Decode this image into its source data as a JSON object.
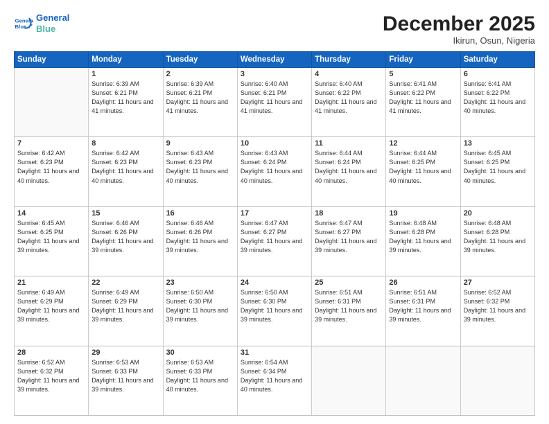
{
  "header": {
    "logo_line1": "General",
    "logo_line2": "Blue",
    "month": "December 2025",
    "location": "Ikirun, Osun, Nigeria"
  },
  "weekdays": [
    "Sunday",
    "Monday",
    "Tuesday",
    "Wednesday",
    "Thursday",
    "Friday",
    "Saturday"
  ],
  "weeks": [
    [
      {
        "day": "",
        "empty": true
      },
      {
        "day": "1",
        "sunrise": "6:39 AM",
        "sunset": "6:21 PM",
        "daylight": "11 hours and 41 minutes."
      },
      {
        "day": "2",
        "sunrise": "6:39 AM",
        "sunset": "6:21 PM",
        "daylight": "11 hours and 41 minutes."
      },
      {
        "day": "3",
        "sunrise": "6:40 AM",
        "sunset": "6:21 PM",
        "daylight": "11 hours and 41 minutes."
      },
      {
        "day": "4",
        "sunrise": "6:40 AM",
        "sunset": "6:22 PM",
        "daylight": "11 hours and 41 minutes."
      },
      {
        "day": "5",
        "sunrise": "6:41 AM",
        "sunset": "6:22 PM",
        "daylight": "11 hours and 41 minutes."
      },
      {
        "day": "6",
        "sunrise": "6:41 AM",
        "sunset": "6:22 PM",
        "daylight": "11 hours and 40 minutes."
      }
    ],
    [
      {
        "day": "7",
        "sunrise": "6:42 AM",
        "sunset": "6:23 PM",
        "daylight": "11 hours and 40 minutes."
      },
      {
        "day": "8",
        "sunrise": "6:42 AM",
        "sunset": "6:23 PM",
        "daylight": "11 hours and 40 minutes."
      },
      {
        "day": "9",
        "sunrise": "6:43 AM",
        "sunset": "6:23 PM",
        "daylight": "11 hours and 40 minutes."
      },
      {
        "day": "10",
        "sunrise": "6:43 AM",
        "sunset": "6:24 PM",
        "daylight": "11 hours and 40 minutes."
      },
      {
        "day": "11",
        "sunrise": "6:44 AM",
        "sunset": "6:24 PM",
        "daylight": "11 hours and 40 minutes."
      },
      {
        "day": "12",
        "sunrise": "6:44 AM",
        "sunset": "6:25 PM",
        "daylight": "11 hours and 40 minutes."
      },
      {
        "day": "13",
        "sunrise": "6:45 AM",
        "sunset": "6:25 PM",
        "daylight": "11 hours and 40 minutes."
      }
    ],
    [
      {
        "day": "14",
        "sunrise": "6:45 AM",
        "sunset": "6:25 PM",
        "daylight": "11 hours and 39 minutes."
      },
      {
        "day": "15",
        "sunrise": "6:46 AM",
        "sunset": "6:26 PM",
        "daylight": "11 hours and 39 minutes."
      },
      {
        "day": "16",
        "sunrise": "6:46 AM",
        "sunset": "6:26 PM",
        "daylight": "11 hours and 39 minutes."
      },
      {
        "day": "17",
        "sunrise": "6:47 AM",
        "sunset": "6:27 PM",
        "daylight": "11 hours and 39 minutes."
      },
      {
        "day": "18",
        "sunrise": "6:47 AM",
        "sunset": "6:27 PM",
        "daylight": "11 hours and 39 minutes."
      },
      {
        "day": "19",
        "sunrise": "6:48 AM",
        "sunset": "6:28 PM",
        "daylight": "11 hours and 39 minutes."
      },
      {
        "day": "20",
        "sunrise": "6:48 AM",
        "sunset": "6:28 PM",
        "daylight": "11 hours and 39 minutes."
      }
    ],
    [
      {
        "day": "21",
        "sunrise": "6:49 AM",
        "sunset": "6:29 PM",
        "daylight": "11 hours and 39 minutes."
      },
      {
        "day": "22",
        "sunrise": "6:49 AM",
        "sunset": "6:29 PM",
        "daylight": "11 hours and 39 minutes."
      },
      {
        "day": "23",
        "sunrise": "6:50 AM",
        "sunset": "6:30 PM",
        "daylight": "11 hours and 39 minutes."
      },
      {
        "day": "24",
        "sunrise": "6:50 AM",
        "sunset": "6:30 PM",
        "daylight": "11 hours and 39 minutes."
      },
      {
        "day": "25",
        "sunrise": "6:51 AM",
        "sunset": "6:31 PM",
        "daylight": "11 hours and 39 minutes."
      },
      {
        "day": "26",
        "sunrise": "6:51 AM",
        "sunset": "6:31 PM",
        "daylight": "11 hours and 39 minutes."
      },
      {
        "day": "27",
        "sunrise": "6:52 AM",
        "sunset": "6:32 PM",
        "daylight": "11 hours and 39 minutes."
      }
    ],
    [
      {
        "day": "28",
        "sunrise": "6:52 AM",
        "sunset": "6:32 PM",
        "daylight": "11 hours and 39 minutes."
      },
      {
        "day": "29",
        "sunrise": "6:53 AM",
        "sunset": "6:33 PM",
        "daylight": "11 hours and 39 minutes."
      },
      {
        "day": "30",
        "sunrise": "6:53 AM",
        "sunset": "6:33 PM",
        "daylight": "11 hours and 40 minutes."
      },
      {
        "day": "31",
        "sunrise": "6:54 AM",
        "sunset": "6:34 PM",
        "daylight": "11 hours and 40 minutes."
      },
      {
        "day": "",
        "empty": true
      },
      {
        "day": "",
        "empty": true
      },
      {
        "day": "",
        "empty": true
      }
    ]
  ]
}
